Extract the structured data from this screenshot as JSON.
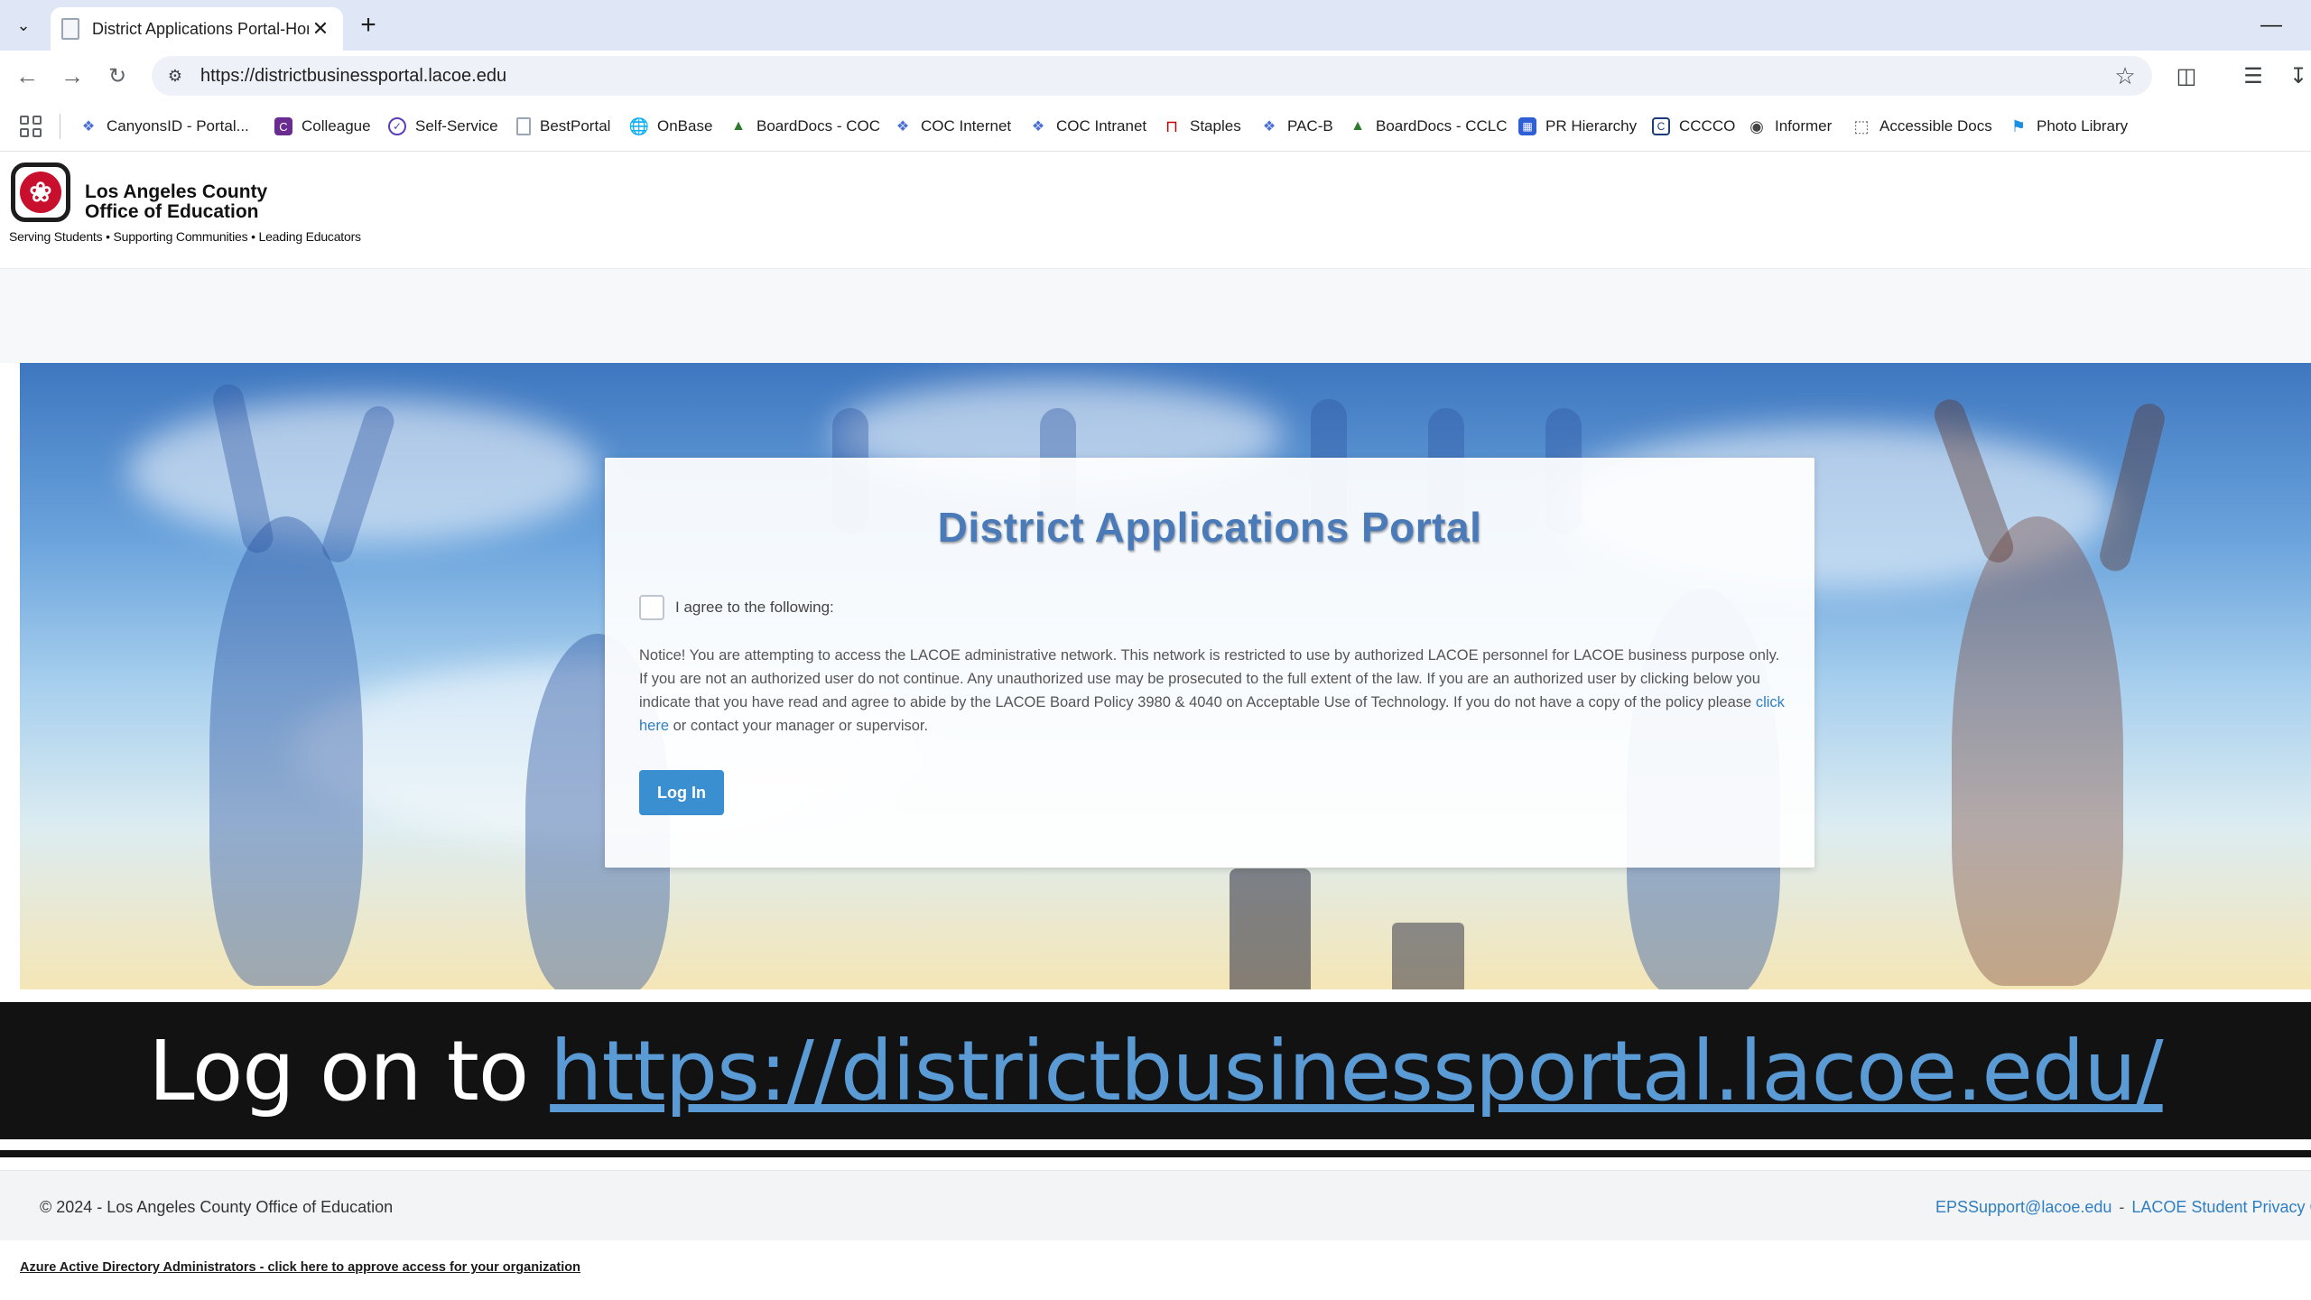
{
  "browser": {
    "tab_title": "District Applications Portal-Hom",
    "url": "https://districtbusinessportal.lacoe.edu",
    "bookmarks": [
      {
        "label": "CanyonsID - Portal..."
      },
      {
        "label": "Colleague"
      },
      {
        "label": "Self-Service"
      },
      {
        "label": "BestPortal"
      },
      {
        "label": "OnBase"
      },
      {
        "label": "BoardDocs - COC"
      },
      {
        "label": "COC Internet"
      },
      {
        "label": "COC Intranet"
      },
      {
        "label": "Staples"
      },
      {
        "label": "PAC-B"
      },
      {
        "label": "BoardDocs - CCLC"
      },
      {
        "label": "PR Hierarchy"
      },
      {
        "label": "CCCCO"
      },
      {
        "label": "Informer"
      },
      {
        "label": "Accessible Docs"
      },
      {
        "label": "Photo Library"
      }
    ]
  },
  "header": {
    "org_line1": "Los Angeles County",
    "org_line2": "Office of Education",
    "tagline": "Serving Students • Supporting Communities • Leading Educators"
  },
  "card": {
    "title": "District Applications Portal",
    "agree_label": "I agree to the following:",
    "notice_text": "Notice! You are attempting to access the LACOE administrative network. This network is restricted to use by authorized LACOE personnel for LACOE business purpose only. If you are not an authorized user do not continue. Any unauthorized use may be prosecuted to the full extent of the law. If you are an authorized user by clicking below you indicate that you have read and agree to abide by the LACOE Board Policy 3980 & 4040 on Acceptable Use of Technology. If you do not have a copy of the policy please ",
    "notice_link": "click here",
    "notice_tail": " or contact your manager or supervisor.",
    "login_label": "Log In"
  },
  "caption": {
    "prefix": "Log on to",
    "link": "https://districtbusinessportal.lacoe.edu/"
  },
  "footer": {
    "copyright": "© 2024 - Los Angeles County Office of Education",
    "support_email": "EPSSupport@lacoe.edu",
    "separator": "-",
    "privacy_link": "LACOE Student Privacy G",
    "azure_link": "Azure Active Directory Administrators - click here to approve access for your organization"
  },
  "colors": {
    "accent": "#3a8fd0",
    "title": "#4a7ab8",
    "link": "#2f7fc1",
    "caption_link": "#5b9bd5",
    "logo_red": "#c8102e"
  }
}
